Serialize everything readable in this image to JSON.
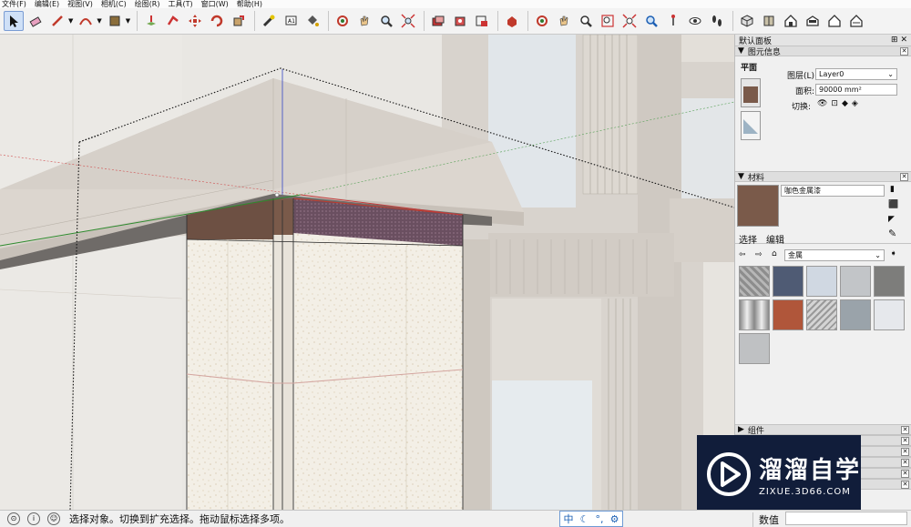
{
  "menu": [
    "文件(F)",
    "编辑(E)",
    "视图(V)",
    "相机(C)",
    "绘图(R)",
    "工具(T)",
    "窗口(W)",
    "帮助(H)"
  ],
  "toolbar": {
    "tools": [
      "select-icon",
      "eraser-icon",
      "pencil-icon",
      "arc-icon",
      "shape-icon",
      "push-pull-icon",
      "follow-me-icon",
      "move-icon",
      "rotate-icon",
      "scale-icon",
      "tape-measure-icon",
      "text-icon",
      "paint-bucket-icon",
      "orbit-icon",
      "pan-icon",
      "zoom-icon",
      "zoom-extents-icon",
      "section-icon",
      "section-display-icon",
      "section-cut-icon",
      "warehouse-icon",
      "orbit2-icon",
      "pan2-icon",
      "zoom2-icon",
      "zoom-window-icon",
      "zoom-extents2-icon",
      "previous-view-icon",
      "position-camera-icon",
      "look-around-icon",
      "walk-icon",
      "iso-view-icon",
      "top-view-icon",
      "front-view-icon",
      "right-view-icon",
      "back-view-icon",
      "left-view-icon"
    ]
  },
  "panel": {
    "title": "默认面板",
    "entity_info": {
      "header": "图元信息",
      "type": "平面",
      "layer_label": "图层(L):",
      "layer_value": "Layer0",
      "area_label": "面积:",
      "area_value": "90000 mm²",
      "toggle_label": "切换:"
    },
    "materials": {
      "header": "材料",
      "name": "咖色金属漆",
      "tab_select": "选择",
      "tab_edit": "编辑",
      "library": "金属",
      "swatch_color": "#7a5a4a"
    },
    "collapsed": [
      "组件"
    ]
  },
  "status": {
    "text": "选择对象。切换到扩充选择。拖动鼠标选择多项。",
    "ime": "中",
    "vcb_label": "数值",
    "vcb_value": ""
  },
  "watermark": {
    "name": "溜溜自学",
    "url": "ZIXUE.3D66.COM"
  }
}
